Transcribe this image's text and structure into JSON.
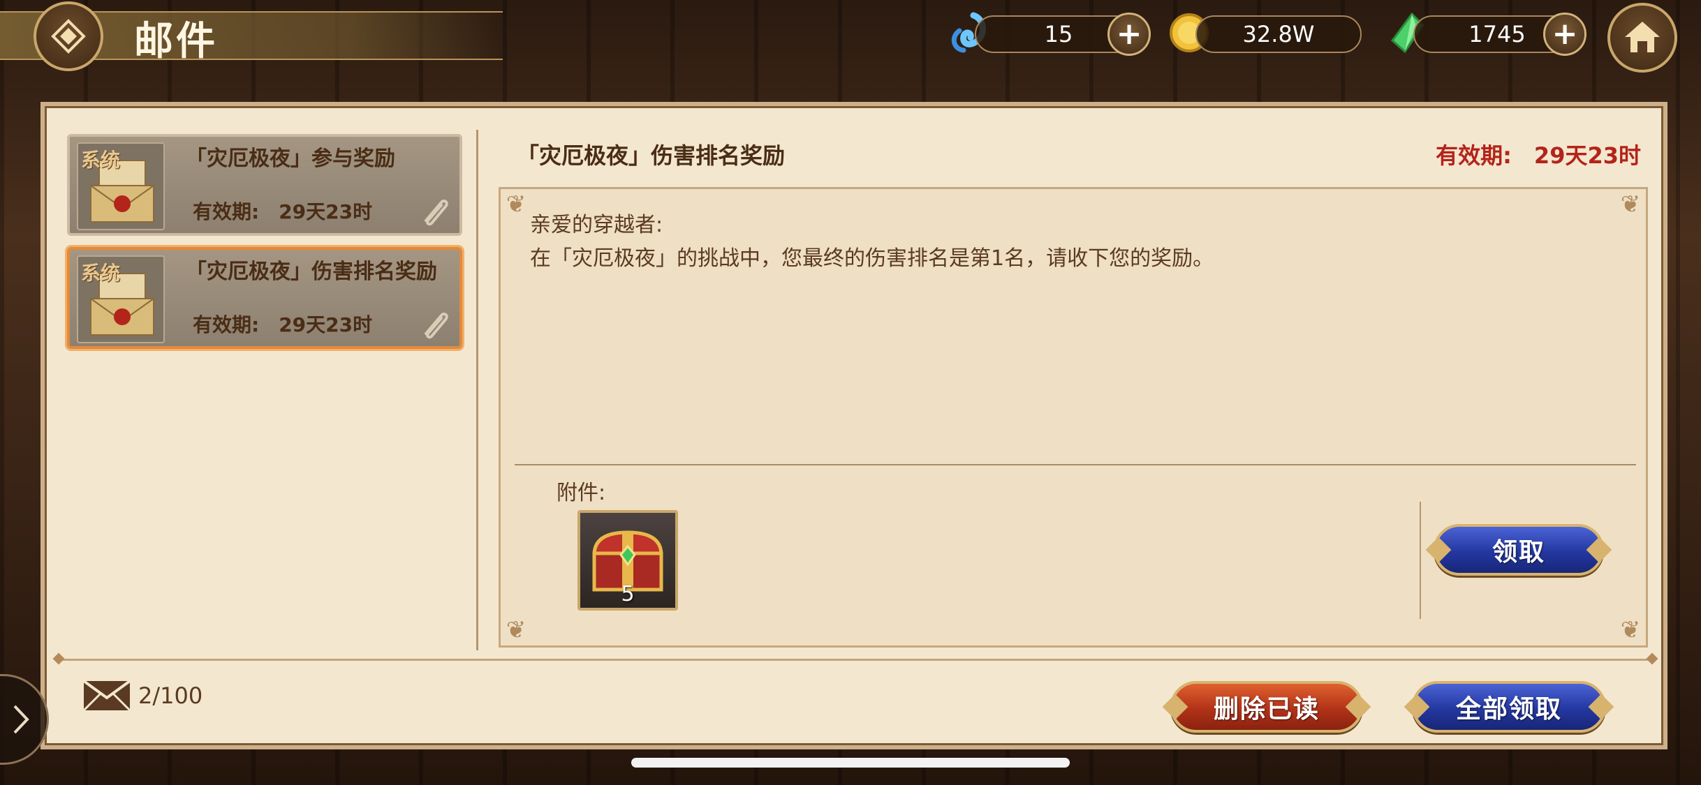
{
  "header": {
    "title": "邮件",
    "resources": [
      {
        "name": "blue-spirit",
        "value": "15",
        "has_plus": true
      },
      {
        "name": "gold-coin",
        "value": "32.8W",
        "has_plus": false
      },
      {
        "name": "green-crystal",
        "value": "1745",
        "has_plus": true
      }
    ]
  },
  "mail_list": {
    "items": [
      {
        "tag": "系统",
        "title": "「灾厄极夜」参与奖励",
        "expiry": "有效期:　29天23时",
        "selected": false
      },
      {
        "tag": "系统",
        "title": "「灾厄极夜」伤害排名奖励",
        "expiry": "有效期:　29天23时",
        "selected": true
      }
    ]
  },
  "detail": {
    "title": "「灾厄极夜」伤害排名奖励",
    "expiry": "有效期:　29天23时",
    "greeting": "亲爱的穿越者:",
    "body": "在「灾厄极夜」的挑战中，您最终的伤害排名是第1名，请收下您的奖励。",
    "attachment_label": "附件:",
    "attachment_count": "5",
    "claim_button": "领取"
  },
  "footer": {
    "mail_count": "2/100",
    "delete_read_button": "删除已读",
    "claim_all_button": "全部领取"
  },
  "colors": {
    "panel_bg": "#f4e7d0",
    "expiry_red": "#b3241a",
    "selected_border": "#e38a3b",
    "button_blue": "#2437a0",
    "button_red": "#b23218"
  }
}
